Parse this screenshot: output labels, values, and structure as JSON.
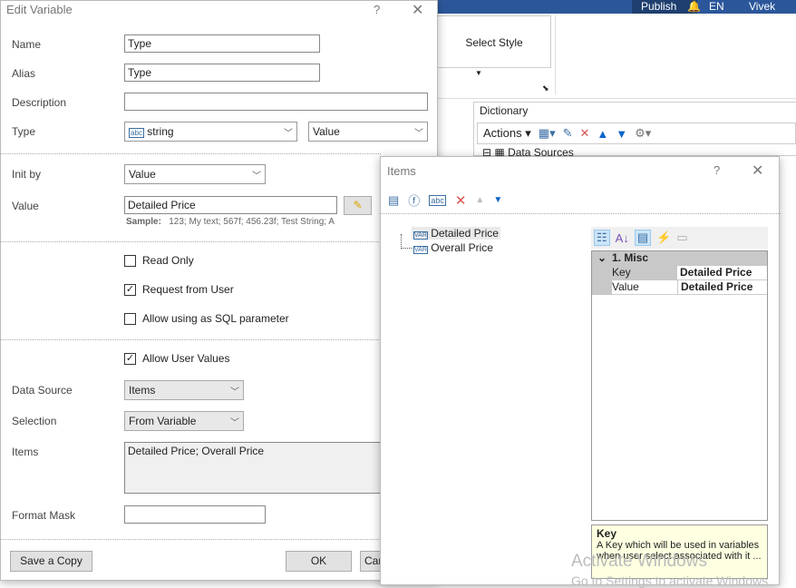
{
  "background": {
    "publish": "Publish",
    "lang": "EN",
    "user": "Vivek Rao",
    "select_style": "Select Style",
    "dictionary": "Dictionary",
    "actions": "Actions",
    "data_sources": "Data Sources"
  },
  "edit_variable": {
    "title": "Edit Variable",
    "help": "?",
    "close": "✕",
    "name_label": "Name",
    "name_value": "Type",
    "alias_label": "Alias",
    "alias_value": "Type",
    "description_label": "Description",
    "description_value": "",
    "type_label": "Type",
    "type_value": "string",
    "type_kind": "Value",
    "init_by_label": "Init by",
    "init_by_value": "Value",
    "value_label": "Value",
    "value_value": "Detailed Price",
    "sample_label": "Sample:",
    "sample_text": "123; My text; 567f; 456.23f; Test String; A",
    "read_only": "Read Only",
    "request_from_user": "Request from User",
    "allow_sql": "Allow using as SQL parameter",
    "allow_user_values": "Allow User Values",
    "checks": {
      "read_only": false,
      "request_from_user": true,
      "allow_sql": false,
      "allow_user_values": true
    },
    "data_source_label": "Data Source",
    "data_source_value": "Items",
    "selection_label": "Selection",
    "selection_value": "From Variable",
    "items_label": "Items",
    "items_value": "Detailed Price; Overall Price",
    "format_mask_label": "Format Mask",
    "format_mask_value": "",
    "save_copy": "Save a Copy",
    "ok": "OK",
    "cancel": "Cancel"
  },
  "items_dialog": {
    "title": "Items",
    "help": "?",
    "close": "✕",
    "tree": [
      "Detailed Price",
      "Overall Price"
    ],
    "category": "1. Misc",
    "props": [
      {
        "key": "Key",
        "value": "Detailed Price"
      },
      {
        "key": "Value",
        "value": "Detailed Price"
      }
    ],
    "help_title": "Key",
    "help_text": "A Key which will be used in variables when user select associated with it ..."
  },
  "watermark": {
    "line1": "Activate Windows",
    "line2": "Go to Settings to activate Windows."
  }
}
